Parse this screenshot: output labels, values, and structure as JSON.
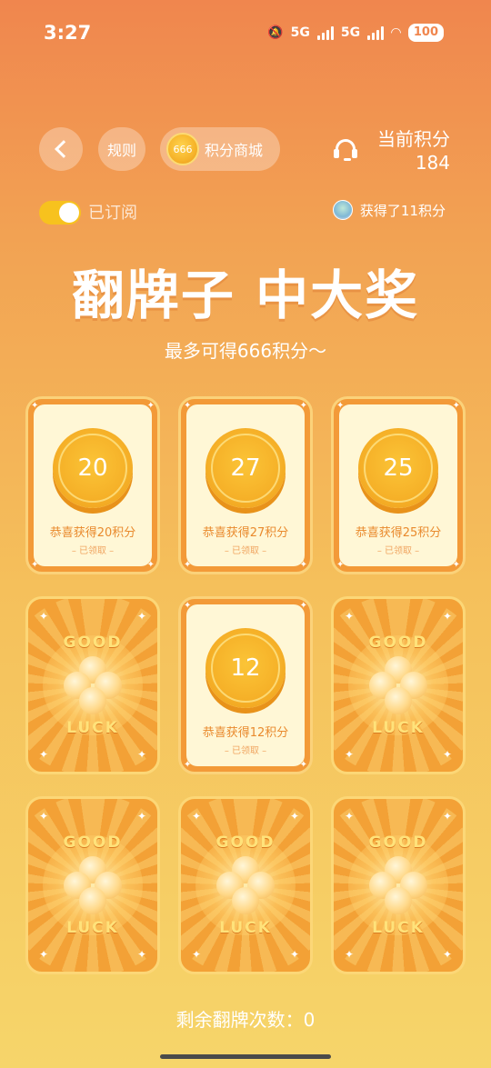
{
  "status_bar": {
    "time": "3:27",
    "net1": "5G",
    "net2": "5G",
    "battery": "100",
    "icons": [
      "mute-icon",
      "signal-icon",
      "signal-icon",
      "wifi-icon",
      "battery-icon"
    ]
  },
  "header": {
    "rules_label": "规则",
    "mall_coin": "666",
    "mall_label": "积分商城",
    "points_label": "当前积分",
    "points_value": "184"
  },
  "subscription": {
    "label": "已订阅",
    "enabled": true
  },
  "ticker": {
    "text": "获得了11积分"
  },
  "title": "翻牌子 中大奖",
  "subtitle": "最多可得666积分～",
  "cards": [
    {
      "state": "revealed",
      "value": "20",
      "won": "恭喜获得20积分",
      "claimed": "– 已领取 –"
    },
    {
      "state": "revealed",
      "value": "27",
      "won": "恭喜获得27积分",
      "claimed": "– 已领取 –"
    },
    {
      "state": "revealed",
      "value": "25",
      "won": "恭喜获得25积分",
      "claimed": "– 已领取 –"
    },
    {
      "state": "back",
      "good": "GOOD",
      "luck": "LUCK"
    },
    {
      "state": "revealed",
      "value": "12",
      "won": "恭喜获得12积分",
      "claimed": "– 已领取 –"
    },
    {
      "state": "back",
      "good": "GOOD",
      "luck": "LUCK"
    },
    {
      "state": "back",
      "good": "GOOD",
      "luck": "LUCK"
    },
    {
      "state": "back",
      "good": "GOOD",
      "luck": "LUCK"
    },
    {
      "state": "back",
      "good": "GOOD",
      "luck": "LUCK"
    }
  ],
  "remaining_label": "剩余翻牌次数：0",
  "colors": {
    "bg_top": "#F0864E",
    "bg_bottom": "#F6D56A",
    "card_orange": "#F39A38",
    "card_inner": "#FFF7D6",
    "coin": "#F6B229",
    "toggle": "#F7C21E"
  }
}
